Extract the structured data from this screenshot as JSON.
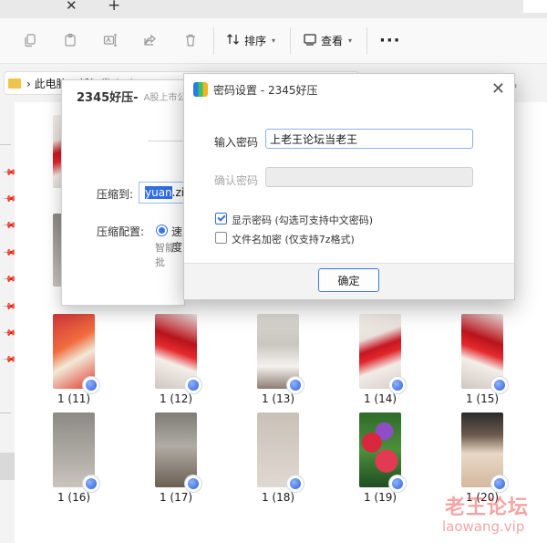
{
  "explorer": {
    "tab_close_glyph": "✕",
    "tab_new_glyph": "+",
    "toolbar": {
      "sort_label": "排序",
      "view_label": "查看",
      "more_label": "···",
      "icons": [
        "copy-icon",
        "paste-icon",
        "rename-icon",
        "share-icon",
        "delete-icon",
        "sort-icon",
        "view-icon"
      ]
    },
    "address": {
      "crumbs": "› 此电脑 › 新加卷 (A:) › ..."
    },
    "files": [
      {
        "label": "1 (11)"
      },
      {
        "label": "1 (12)"
      },
      {
        "label": "1 (13)"
      },
      {
        "label": "1 (14)"
      },
      {
        "label": "1 (15)"
      },
      {
        "label": "1 (16)"
      },
      {
        "label": "1 (17)"
      },
      {
        "label": "1 (18)"
      },
      {
        "label": "1 (19)"
      },
      {
        "label": "1 (20)"
      }
    ]
  },
  "zip_dialog": {
    "title": "2345好压-",
    "subtitle": "A股上市公",
    "compress_to_label": "压缩到:",
    "compress_to_selected": "yuan",
    "compress_to_rest": ".zip",
    "config_label": "压缩配置:",
    "mode_label": "速度",
    "smart_label": "智能批"
  },
  "password_dialog": {
    "title": "密码设置 - 2345好压",
    "close_glyph": "✕",
    "enter_label": "输入密码",
    "password_value": "上老王论坛当老王",
    "confirm_label": "确认密码",
    "confirm_value": "",
    "show_password_label": "显示密码 (勾选可支持中文密码)",
    "show_password_checked": true,
    "encrypt_names_label": "文件名加密 (仅支持7z格式)",
    "encrypt_names_checked": false,
    "ok_label": "确定"
  },
  "watermark": {
    "line1": "老王论坛",
    "line2": "laowang.vip"
  },
  "colors": {
    "accent": "#2f6ee6",
    "watermark": "#ec5a5a"
  }
}
